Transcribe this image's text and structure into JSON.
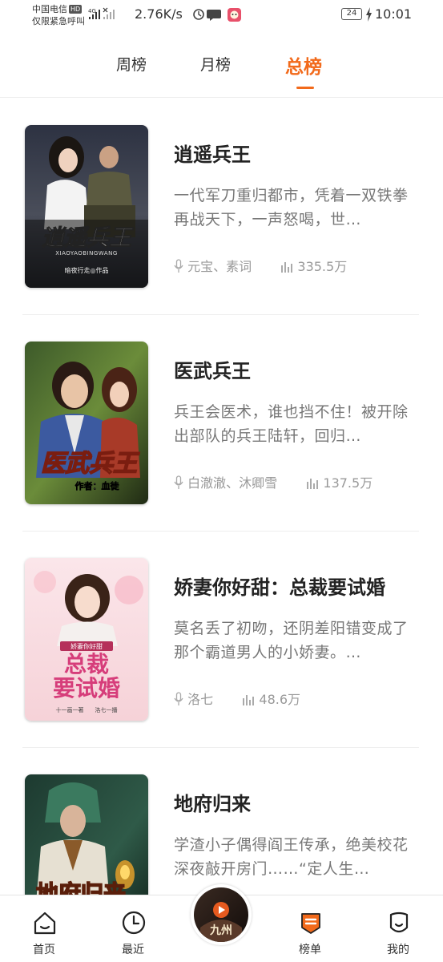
{
  "status_bar": {
    "carrier": "中国电信",
    "hd": "HD",
    "emergency": "仅限紧急呼叫",
    "network": "4G",
    "speed": "2.76K/s",
    "battery": "24",
    "time": "10:01"
  },
  "tabs": [
    {
      "label": "周榜",
      "active": false
    },
    {
      "label": "月榜",
      "active": false
    },
    {
      "label": "总榜",
      "active": true
    }
  ],
  "accent_color": "#f26a1b",
  "books": [
    {
      "title": "逍遥兵王",
      "description": "一代军刀重归都市，凭着一双铁拳再战天下，一声怒喝，世…",
      "narrators": "元宝、素词",
      "plays": "335.5万",
      "cover_text": "逍遥兵王",
      "cover_sub": "XIAOYAOBINGWANG",
      "cover_author": "暗夜行走◎作品"
    },
    {
      "title": "医武兵王",
      "description": "兵王会医术，谁也挡不住！被开除出部队的兵王陆轩，回归…",
      "narrators": "白澈澈、沐卿雪",
      "plays": "137.5万",
      "cover_text": "医武兵王",
      "cover_author": "作者：血徒"
    },
    {
      "title": "娇妻你好甜：总裁要试婚",
      "description": "莫名丢了初吻，还阴差阳错变成了那个霸道男人的小娇妻。…",
      "narrators": "洛七",
      "plays": "48.6万",
      "cover_top": "娇妻你好甜",
      "cover_line1": "总裁",
      "cover_line2": "要试婚",
      "cover_author": "十一画一著　　洛七一播"
    },
    {
      "title": "地府归来",
      "description": "学渣小子偶得阎王传承，绝美校花深夜敲开房门……“定人生…",
      "cover_text": "地府归来"
    }
  ],
  "bottom_nav": [
    {
      "label": "首页",
      "icon": "home-icon"
    },
    {
      "label": "最近",
      "icon": "clock-icon"
    },
    {
      "label": "",
      "icon": "now-playing-disc"
    },
    {
      "label": "榜单",
      "icon": "ranking-icon"
    },
    {
      "label": "我的",
      "icon": "profile-icon"
    }
  ],
  "now_playing_cover_text": "九州"
}
